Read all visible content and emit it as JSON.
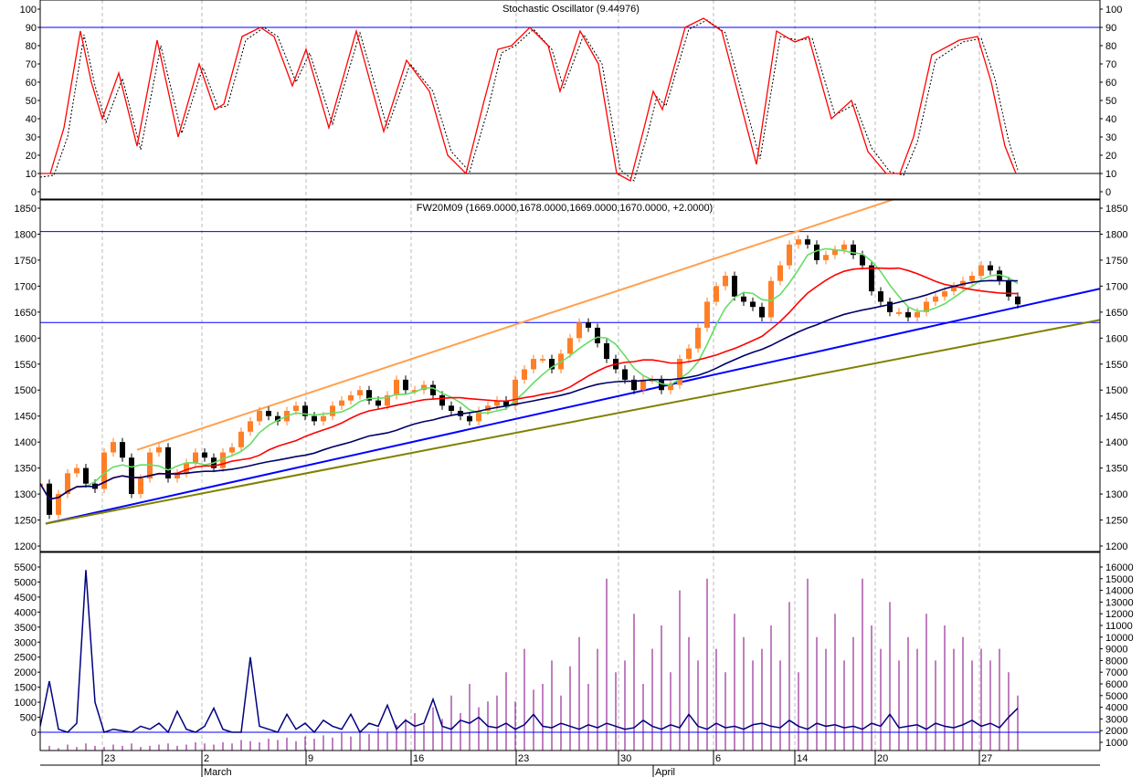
{
  "chart_data": [
    {
      "type": "line",
      "title": "Stochastic Oscillator (9.44976)",
      "ylim": [
        0,
        100
      ],
      "yticks": [
        0,
        10,
        20,
        30,
        40,
        50,
        60,
        70,
        80,
        90,
        100
      ],
      "reference_lines": [
        {
          "value": 90,
          "color": "#0000ff"
        },
        {
          "value": 10,
          "color": "#000000"
        }
      ],
      "series": [
        {
          "name": "%K",
          "color": "#ff0000",
          "style": "solid",
          "points": [
            [
              0,
              10
            ],
            [
              1.1,
              10
            ],
            [
              2.6,
              35
            ],
            [
              4.4,
              88
            ],
            [
              5.6,
              60
            ],
            [
              6.8,
              40
            ],
            [
              8.6,
              65
            ],
            [
              10.6,
              25
            ],
            [
              12.8,
              83
            ],
            [
              15.1,
              30
            ],
            [
              17.4,
              70
            ],
            [
              19.1,
              45
            ],
            [
              20.1,
              48
            ],
            [
              22.1,
              85
            ],
            [
              24.1,
              90
            ],
            [
              25.6,
              85
            ],
            [
              27.6,
              58
            ],
            [
              29.1,
              78
            ],
            [
              31.6,
              35
            ],
            [
              34.6,
              88
            ],
            [
              37.6,
              33
            ],
            [
              40.1,
              72
            ],
            [
              42.6,
              55
            ],
            [
              44.6,
              20
            ],
            [
              46.6,
              10
            ],
            [
              48.6,
              50
            ],
            [
              50.1,
              78
            ],
            [
              51.6,
              80
            ],
            [
              53.6,
              90
            ],
            [
              55.6,
              80
            ],
            [
              56.9,
              55
            ],
            [
              59.1,
              88
            ],
            [
              61.1,
              70
            ],
            [
              63.1,
              10
            ],
            [
              64.6,
              6
            ],
            [
              66.1,
              35
            ],
            [
              67.1,
              55
            ],
            [
              68.1,
              45
            ],
            [
              70.6,
              90
            ],
            [
              72.6,
              95
            ],
            [
              74.6,
              88
            ],
            [
              78.4,
              15
            ],
            [
              80.6,
              88
            ],
            [
              82.6,
              82
            ],
            [
              84.1,
              85
            ],
            [
              86.6,
              40
            ],
            [
              88.8,
              50
            ],
            [
              90.6,
              22
            ],
            [
              92.6,
              10
            ],
            [
              94.1,
              10
            ],
            [
              95.6,
              30
            ],
            [
              97.6,
              75
            ],
            [
              100.6,
              83
            ],
            [
              102.6,
              85
            ],
            [
              104.1,
              60
            ],
            [
              105.6,
              25
            ],
            [
              106.8,
              10
            ]
          ]
        },
        {
          "name": "%D",
          "color": "#000000",
          "style": "dotted",
          "points": [
            [
              0,
              8
            ],
            [
              1.5,
              9
            ],
            [
              3,
              30
            ],
            [
              4.8,
              86
            ],
            [
              6,
              58
            ],
            [
              7.2,
              38
            ],
            [
              9,
              62
            ],
            [
              11,
              23
            ],
            [
              13.2,
              80
            ],
            [
              15.5,
              32
            ],
            [
              17.8,
              68
            ],
            [
              19.5,
              46
            ],
            [
              20.5,
              47
            ],
            [
              22.5,
              83
            ],
            [
              24.5,
              90
            ],
            [
              26,
              85
            ],
            [
              28,
              60
            ],
            [
              29.5,
              76
            ],
            [
              32,
              37
            ],
            [
              35,
              87
            ],
            [
              38,
              35
            ],
            [
              40.5,
              70
            ],
            [
              43,
              55
            ],
            [
              45,
              22
            ],
            [
              47,
              11
            ],
            [
              49,
              45
            ],
            [
              50.5,
              76
            ],
            [
              52,
              80
            ],
            [
              54,
              89
            ],
            [
              56,
              78
            ],
            [
              57.3,
              57
            ],
            [
              59.5,
              86
            ],
            [
              61.5,
              70
            ],
            [
              63.5,
              12
            ],
            [
              65,
              6
            ],
            [
              66.5,
              32
            ],
            [
              67.5,
              52
            ],
            [
              68.5,
              47
            ],
            [
              71,
              89
            ],
            [
              73,
              94
            ],
            [
              75,
              87
            ],
            [
              78.8,
              18
            ],
            [
              81,
              85
            ],
            [
              83,
              83
            ],
            [
              84.5,
              84
            ],
            [
              87,
              42
            ],
            [
              89.2,
              48
            ],
            [
              91,
              24
            ],
            [
              93,
              11
            ],
            [
              94.5,
              9
            ],
            [
              96,
              27
            ],
            [
              98,
              72
            ],
            [
              101,
              82
            ],
            [
              103,
              84
            ],
            [
              104.5,
              62
            ],
            [
              106,
              28
            ],
            [
              107,
              12
            ]
          ]
        }
      ]
    },
    {
      "type": "candlestick",
      "title": "FW20M09 (1669.0000,1678.0000,1669.0000,1670.0000, +2.0000)",
      "ylim": [
        1200,
        1850
      ],
      "yticks": [
        1200,
        1250,
        1300,
        1350,
        1400,
        1450,
        1500,
        1550,
        1600,
        1650,
        1700,
        1750,
        1800,
        1850
      ],
      "up_color": "#ff7f27",
      "down_color": "#000000",
      "close": [
        1320,
        1260,
        1300,
        1340,
        1350,
        1320,
        1310,
        1380,
        1400,
        1370,
        1300,
        1330,
        1380,
        1390,
        1330,
        1340,
        1360,
        1380,
        1370,
        1350,
        1380,
        1390,
        1420,
        1440,
        1460,
        1450,
        1440,
        1460,
        1470,
        1450,
        1440,
        1450,
        1470,
        1480,
        1490,
        1500,
        1480,
        1470,
        1490,
        1520,
        1500,
        1500,
        1510,
        1490,
        1470,
        1460,
        1450,
        1440,
        1460,
        1470,
        1480,
        1470,
        1520,
        1540,
        1560,
        1560,
        1540,
        1570,
        1600,
        1630,
        1620,
        1590,
        1560,
        1540,
        1520,
        1500,
        1520,
        1520,
        1500,
        1510,
        1560,
        1580,
        1620,
        1670,
        1700,
        1720,
        1680,
        1670,
        1660,
        1640,
        1710,
        1740,
        1780,
        1790,
        1780,
        1750,
        1760,
        1770,
        1780,
        1760,
        1740,
        1690,
        1670,
        1650,
        1650,
        1640,
        1650,
        1670,
        1680,
        1690,
        1700,
        1710,
        1720,
        1740,
        1730,
        1710,
        1680,
        1665
      ],
      "moving_averages": [
        {
          "period": 5,
          "color": "#66dd66"
        },
        {
          "period": 15,
          "color": "#ff0000"
        },
        {
          "period": 30,
          "color": "#000066"
        }
      ],
      "horizontal_lines": [
        {
          "value": 1805,
          "color": "#0000ff"
        },
        {
          "value": 1630,
          "color": "#0000ff"
        }
      ],
      "trend_lines": [
        {
          "name": "upper-channel",
          "color": "#ffa050",
          "from": [
            10.6,
            1385
          ],
          "to": [
            93.6,
            1868
          ]
        },
        {
          "name": "support-blue",
          "color": "#0000ff",
          "from": [
            0.6,
            1243
          ],
          "to": [
            116,
            1695
          ]
        },
        {
          "name": "support-olive",
          "color": "#808000",
          "from": [
            0.6,
            1243
          ],
          "to": [
            116,
            1635
          ]
        }
      ]
    },
    {
      "type": "bar",
      "title": "Volume / Open interest",
      "left_ylim": [
        0,
        5500
      ],
      "left_yticks": [
        0,
        500,
        1000,
        1500,
        2000,
        2500,
        3000,
        3500,
        4000,
        4500,
        5000,
        5500
      ],
      "right_ylim": [
        1000,
        16000
      ],
      "right_yticks": [
        1000,
        2000,
        3000,
        4000,
        5000,
        6000,
        7000,
        8000,
        9000,
        10000,
        11000,
        12000,
        13000,
        14000,
        15000,
        16000
      ],
      "volume_color": "#800080",
      "line_color": "#000080",
      "baseline_color": "#0000ff",
      "volume": [
        600,
        700,
        500,
        800,
        600,
        900,
        700,
        600,
        800,
        700,
        900,
        600,
        700,
        800,
        900,
        700,
        800,
        1000,
        900,
        800,
        1000,
        900,
        1200,
        1100,
        1000,
        1300,
        1200,
        1400,
        1100,
        1500,
        1300,
        1600,
        1400,
        1800,
        1500,
        2000,
        1700,
        2200,
        1900,
        2500,
        3000,
        3500,
        2500,
        4000,
        3000,
        5000,
        3500,
        6000,
        4000,
        4500,
        5000,
        7000,
        4500,
        9000,
        5500,
        6000,
        8000,
        5000,
        7500,
        10000,
        6000,
        9000,
        15000,
        7000,
        8000,
        12000,
        6000,
        9000,
        11000,
        7000,
        14000,
        10000,
        8000,
        15000,
        9000,
        7000,
        12000,
        10000,
        8000,
        9000,
        11000,
        8000,
        13000,
        7000,
        15000,
        10000,
        9000,
        12000,
        8000,
        10000,
        15000,
        11000,
        9000,
        13000,
        8000,
        10000,
        9000,
        12000,
        8000,
        11000,
        9000,
        10000,
        8000,
        9000,
        8000,
        9000,
        7000,
        5000
      ],
      "line": [
        200,
        1700,
        100,
        0,
        300,
        5400,
        1000,
        0,
        100,
        50,
        0,
        200,
        100,
        300,
        0,
        700,
        100,
        0,
        200,
        800,
        100,
        0,
        0,
        2500,
        200,
        100,
        0,
        600,
        100,
        300,
        0,
        400,
        200,
        100,
        600,
        0,
        300,
        200,
        900,
        100,
        400,
        200,
        300,
        1100,
        200,
        100,
        400,
        300,
        500,
        200,
        150,
        300,
        100,
        250,
        600,
        200,
        150,
        300,
        200,
        100,
        250,
        150,
        300,
        200,
        100,
        150,
        400,
        200,
        100,
        250,
        150,
        600,
        200,
        100,
        300,
        150,
        200,
        100,
        250,
        300,
        200,
        150,
        400,
        200,
        100,
        300,
        200,
        250,
        150,
        200,
        100,
        300,
        200,
        600,
        150,
        200,
        250,
        100,
        300,
        200,
        150,
        250,
        400,
        200,
        300,
        150,
        500,
        800
      ]
    }
  ],
  "x_axis": {
    "day_ticks": [
      {
        "label": "23",
        "index": 6.8
      },
      {
        "label": "2",
        "index": 17.7
      },
      {
        "label": "9",
        "index": 29.1
      },
      {
        "label": "16",
        "index": 40.6
      },
      {
        "label": "23",
        "index": 52.1
      },
      {
        "label": "30",
        "index": 63.3
      },
      {
        "label": "6",
        "index": 73.7
      },
      {
        "label": "14",
        "index": 82.6
      },
      {
        "label": "20",
        "index": 91.4
      },
      {
        "label": "27",
        "index": 102.8
      }
    ],
    "month_ticks": [
      {
        "label": "March",
        "index": 17.7
      },
      {
        "label": "April",
        "index": 67.1
      }
    ]
  }
}
